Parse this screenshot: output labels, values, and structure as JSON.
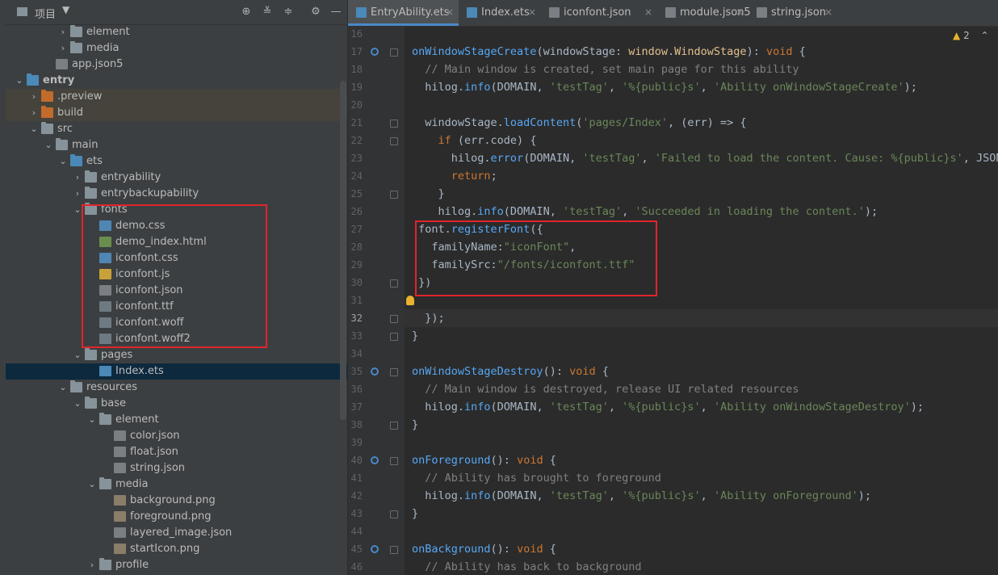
{
  "project_panel": {
    "title": "项目",
    "tree": [
      {
        "label": "element",
        "depth": 4,
        "arrow": "›",
        "icon": "folder"
      },
      {
        "label": "media",
        "depth": 4,
        "arrow": "›",
        "icon": "folder"
      },
      {
        "label": "app.json5",
        "depth": 3,
        "arrow": "",
        "icon": "file json"
      },
      {
        "label": "entry",
        "depth": 1,
        "arrow": "⌄",
        "icon": "folder blue",
        "bold": true
      },
      {
        "label": ".preview",
        "depth": 2,
        "arrow": "›",
        "icon": "folder orange",
        "hl": true
      },
      {
        "label": "build",
        "depth": 2,
        "arrow": "›",
        "icon": "folder orange",
        "hl": true
      },
      {
        "label": "src",
        "depth": 2,
        "arrow": "⌄",
        "icon": "folder"
      },
      {
        "label": "main",
        "depth": 3,
        "arrow": "⌄",
        "icon": "folder"
      },
      {
        "label": "ets",
        "depth": 4,
        "arrow": "⌄",
        "icon": "folder blue"
      },
      {
        "label": "entryability",
        "depth": 5,
        "arrow": "›",
        "icon": "folder"
      },
      {
        "label": "entrybackupability",
        "depth": 5,
        "arrow": "›",
        "icon": "folder"
      },
      {
        "label": "fonts",
        "depth": 5,
        "arrow": "⌄",
        "icon": "folder"
      },
      {
        "label": "demo.css",
        "depth": 6,
        "arrow": "",
        "icon": "file css"
      },
      {
        "label": "demo_index.html",
        "depth": 6,
        "arrow": "",
        "icon": "file html"
      },
      {
        "label": "iconfont.css",
        "depth": 6,
        "arrow": "",
        "icon": "file css"
      },
      {
        "label": "iconfont.js",
        "depth": 6,
        "arrow": "",
        "icon": "file js"
      },
      {
        "label": "iconfont.json",
        "depth": 6,
        "arrow": "",
        "icon": "file json"
      },
      {
        "label": "iconfont.ttf",
        "depth": 6,
        "arrow": "",
        "icon": "file"
      },
      {
        "label": "iconfont.woff",
        "depth": 6,
        "arrow": "",
        "icon": "file"
      },
      {
        "label": "iconfont.woff2",
        "depth": 6,
        "arrow": "",
        "icon": "file"
      },
      {
        "label": "pages",
        "depth": 5,
        "arrow": "⌄",
        "icon": "folder"
      },
      {
        "label": "Index.ets",
        "depth": 6,
        "arrow": "",
        "icon": "file ets",
        "sel": true
      },
      {
        "label": "resources",
        "depth": 4,
        "arrow": "⌄",
        "icon": "folder"
      },
      {
        "label": "base",
        "depth": 5,
        "arrow": "⌄",
        "icon": "folder"
      },
      {
        "label": "element",
        "depth": 6,
        "arrow": "⌄",
        "icon": "folder"
      },
      {
        "label": "color.json",
        "depth": 7,
        "arrow": "",
        "icon": "file json"
      },
      {
        "label": "float.json",
        "depth": 7,
        "arrow": "",
        "icon": "file json"
      },
      {
        "label": "string.json",
        "depth": 7,
        "arrow": "",
        "icon": "file json"
      },
      {
        "label": "media",
        "depth": 6,
        "arrow": "⌄",
        "icon": "folder"
      },
      {
        "label": "background.png",
        "depth": 7,
        "arrow": "",
        "icon": "file png"
      },
      {
        "label": "foreground.png",
        "depth": 7,
        "arrow": "",
        "icon": "file png"
      },
      {
        "label": "layered_image.json",
        "depth": 7,
        "arrow": "",
        "icon": "file json"
      },
      {
        "label": "startIcon.png",
        "depth": 7,
        "arrow": "",
        "icon": "file png"
      },
      {
        "label": "profile",
        "depth": 6,
        "arrow": "›",
        "icon": "folder"
      }
    ]
  },
  "tabs": [
    {
      "label": "EntryAbility.ets",
      "icon": "file ets",
      "active": true
    },
    {
      "label": "Index.ets",
      "icon": "file ets",
      "active": false
    },
    {
      "label": "iconfont.json",
      "icon": "file json",
      "active": false
    },
    {
      "label": "module.json5",
      "icon": "file json",
      "active": false
    },
    {
      "label": "string.json",
      "icon": "file json",
      "active": false
    }
  ],
  "editor": {
    "warning_count": "2",
    "current_line": "32",
    "lines": [
      {
        "n": "16",
        "html": ""
      },
      {
        "n": "17",
        "html": "<span class='me'>onWindowStageCreate</span>(windowStage: <span class='ty'>window</span>.<span class='ty'>WindowStage</span>): <span class='kw'>void</span> {",
        "ovr": true,
        "fold": true
      },
      {
        "n": "18",
        "html": "  <span class='cm'>// Main window is created, set main page for this ability</span>"
      },
      {
        "n": "19",
        "html": "  hilog.<span class='me'>info</span>(DOMAIN, <span class='str'>'testTag'</span>, <span class='str'>'%{public}s'</span>, <span class='str'>'Ability onWindowStageCreate'</span>);"
      },
      {
        "n": "20",
        "html": ""
      },
      {
        "n": "21",
        "html": "  windowStage.<span class='me'>loadContent</span>(<span class='str'>'pages/Index'</span>, (err) => {",
        "fold": true
      },
      {
        "n": "22",
        "html": "    <span class='kw'>if</span> (err.code) {",
        "fold": true
      },
      {
        "n": "23",
        "html": "      hilog.<span class='me'>error</span>(DOMAIN, <span class='str'>'testTag'</span>, <span class='str'>'Failed to load the content. Cause: %{public}s'</span>, JSON."
      },
      {
        "n": "24",
        "html": "      <span class='kw'>return</span>;"
      },
      {
        "n": "25",
        "html": "    }",
        "fold": true
      },
      {
        "n": "26",
        "html": "    hilog.<span class='me'>info</span>(DOMAIN, <span class='str'>'testTag'</span>, <span class='str'>'Succeeded in loading the content.'</span>);"
      },
      {
        "n": "27",
        "html": " font.<span class='me'>registerFont</span>({"
      },
      {
        "n": "28",
        "html": "   familyName:<span class='str'>\"iconFont\"</span>,"
      },
      {
        "n": "29",
        "html": "   familySrc:<span class='str'>\"/fonts/iconfont.ttf\"</span>"
      },
      {
        "n": "30",
        "html": " })",
        "fold": true
      },
      {
        "n": "31",
        "html": "",
        "bulb": true
      },
      {
        "n": "32",
        "html": "  });",
        "fold": true,
        "cur": true
      },
      {
        "n": "33",
        "html": "}",
        "fold": true
      },
      {
        "n": "34",
        "html": ""
      },
      {
        "n": "35",
        "html": "<span class='me'>onWindowStageDestroy</span>(): <span class='kw'>void</span> {",
        "ovr": true,
        "fold": true
      },
      {
        "n": "36",
        "html": "  <span class='cm'>// Main window is destroyed, release UI related resources</span>"
      },
      {
        "n": "37",
        "html": "  hilog.<span class='me'>info</span>(DOMAIN, <span class='str'>'testTag'</span>, <span class='str'>'%{public}s'</span>, <span class='str'>'Ability onWindowStageDestroy'</span>);"
      },
      {
        "n": "38",
        "html": "}",
        "fold": true
      },
      {
        "n": "39",
        "html": ""
      },
      {
        "n": "40",
        "html": "<span class='me'>onForeground</span>(): <span class='kw'>void</span> {",
        "ovr": true,
        "fold": true
      },
      {
        "n": "41",
        "html": "  <span class='cm'>// Ability has brought to foreground</span>"
      },
      {
        "n": "42",
        "html": "  hilog.<span class='me'>info</span>(DOMAIN, <span class='str'>'testTag'</span>, <span class='str'>'%{public}s'</span>, <span class='str'>'Ability onForeground'</span>);"
      },
      {
        "n": "43",
        "html": "}",
        "fold": true
      },
      {
        "n": "44",
        "html": ""
      },
      {
        "n": "45",
        "html": "<span class='me'>onBackground</span>(): <span class='kw'>void</span> {",
        "ovr": true,
        "fold": true
      },
      {
        "n": "46",
        "html": "  <span class='cm'>// Ability has back to background</span>"
      }
    ]
  }
}
